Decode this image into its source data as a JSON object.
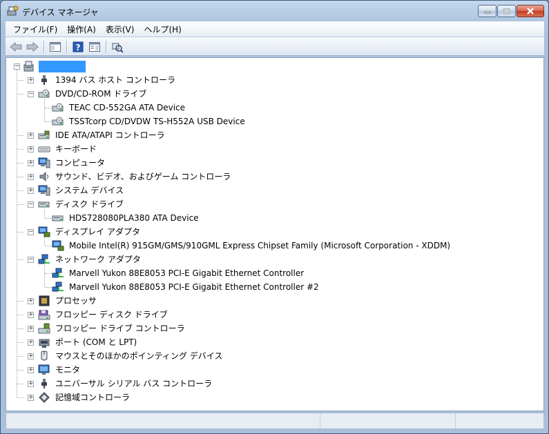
{
  "window": {
    "title": "デバイス マネージャ"
  },
  "menubar": {
    "items": [
      "ファイル(F)",
      "操作(A)",
      "表示(V)",
      "ヘルプ(H)"
    ]
  },
  "tree": {
    "root": {
      "label": ""
    },
    "nodes": [
      {
        "label": "1394 バス ホスト コントローラ",
        "icon": "usb-plug-icon",
        "expanded": false,
        "level": 1
      },
      {
        "label": "DVD/CD-ROM ドライブ",
        "icon": "optical-drive-icon",
        "expanded": true,
        "level": 1
      },
      {
        "label": "TEAC CD-552GA ATA Device",
        "icon": "optical-drive-icon",
        "level": 2
      },
      {
        "label": "TSSTcorp CD/DVDW TS-H552A USB Device",
        "icon": "optical-drive-icon",
        "level": 2
      },
      {
        "label": "IDE ATA/ATAPI コントローラ",
        "icon": "ide-controller-icon",
        "expanded": false,
        "level": 1
      },
      {
        "label": "キーボード",
        "icon": "keyboard-icon",
        "expanded": false,
        "level": 1
      },
      {
        "label": "コンピュータ",
        "icon": "computer-icon",
        "expanded": false,
        "level": 1
      },
      {
        "label": "サウンド、ビデオ、およびゲーム コントローラ",
        "icon": "speaker-icon",
        "expanded": false,
        "level": 1
      },
      {
        "label": "システム デバイス",
        "icon": "computer-icon",
        "expanded": false,
        "level": 1
      },
      {
        "label": "ディスク ドライブ",
        "icon": "disk-drive-icon",
        "expanded": true,
        "level": 1
      },
      {
        "label": "HDS728080PLA380 ATA Device",
        "icon": "disk-drive-icon",
        "level": 2
      },
      {
        "label": "ディスプレイ アダプタ",
        "icon": "display-adapter-icon",
        "expanded": true,
        "level": 1
      },
      {
        "label": "Mobile Intel(R) 915GM/GMS/910GML Express Chipset Family (Microsoft Corporation - XDDM)",
        "icon": "display-adapter-icon",
        "level": 2
      },
      {
        "label": "ネットワーク アダプタ",
        "icon": "network-adapter-icon",
        "expanded": true,
        "level": 1
      },
      {
        "label": "Marvell Yukon 88E8053 PCI-E Gigabit Ethernet Controller",
        "icon": "network-adapter-icon",
        "level": 2
      },
      {
        "label": "Marvell Yukon 88E8053 PCI-E Gigabit Ethernet Controller #2",
        "icon": "network-adapter-icon",
        "level": 2
      },
      {
        "label": "プロセッサ",
        "icon": "processor-icon",
        "expanded": false,
        "level": 1
      },
      {
        "label": "フロッピー ディスク ドライブ",
        "icon": "floppy-drive-icon",
        "expanded": false,
        "level": 1
      },
      {
        "label": "フロッピー ドライブ コントローラ",
        "icon": "floppy-controller-icon",
        "expanded": false,
        "level": 1
      },
      {
        "label": "ポート (COM と LPT)",
        "icon": "port-icon",
        "expanded": false,
        "level": 1
      },
      {
        "label": "マウスとそのほかのポインティング デバイス",
        "icon": "mouse-icon",
        "expanded": false,
        "level": 1
      },
      {
        "label": "モニタ",
        "icon": "monitor-icon",
        "expanded": false,
        "level": 1
      },
      {
        "label": "ユニバーサル シリアル バス コントローラ",
        "icon": "usb-plug-icon",
        "expanded": false,
        "level": 1
      },
      {
        "label": "記憶域コントローラ",
        "icon": "storage-controller-icon",
        "expanded": false,
        "level": 1
      }
    ]
  },
  "colors": {
    "selection": "#3399ff",
    "titlebar": "#c5d8ec",
    "close": "#c13b24"
  }
}
